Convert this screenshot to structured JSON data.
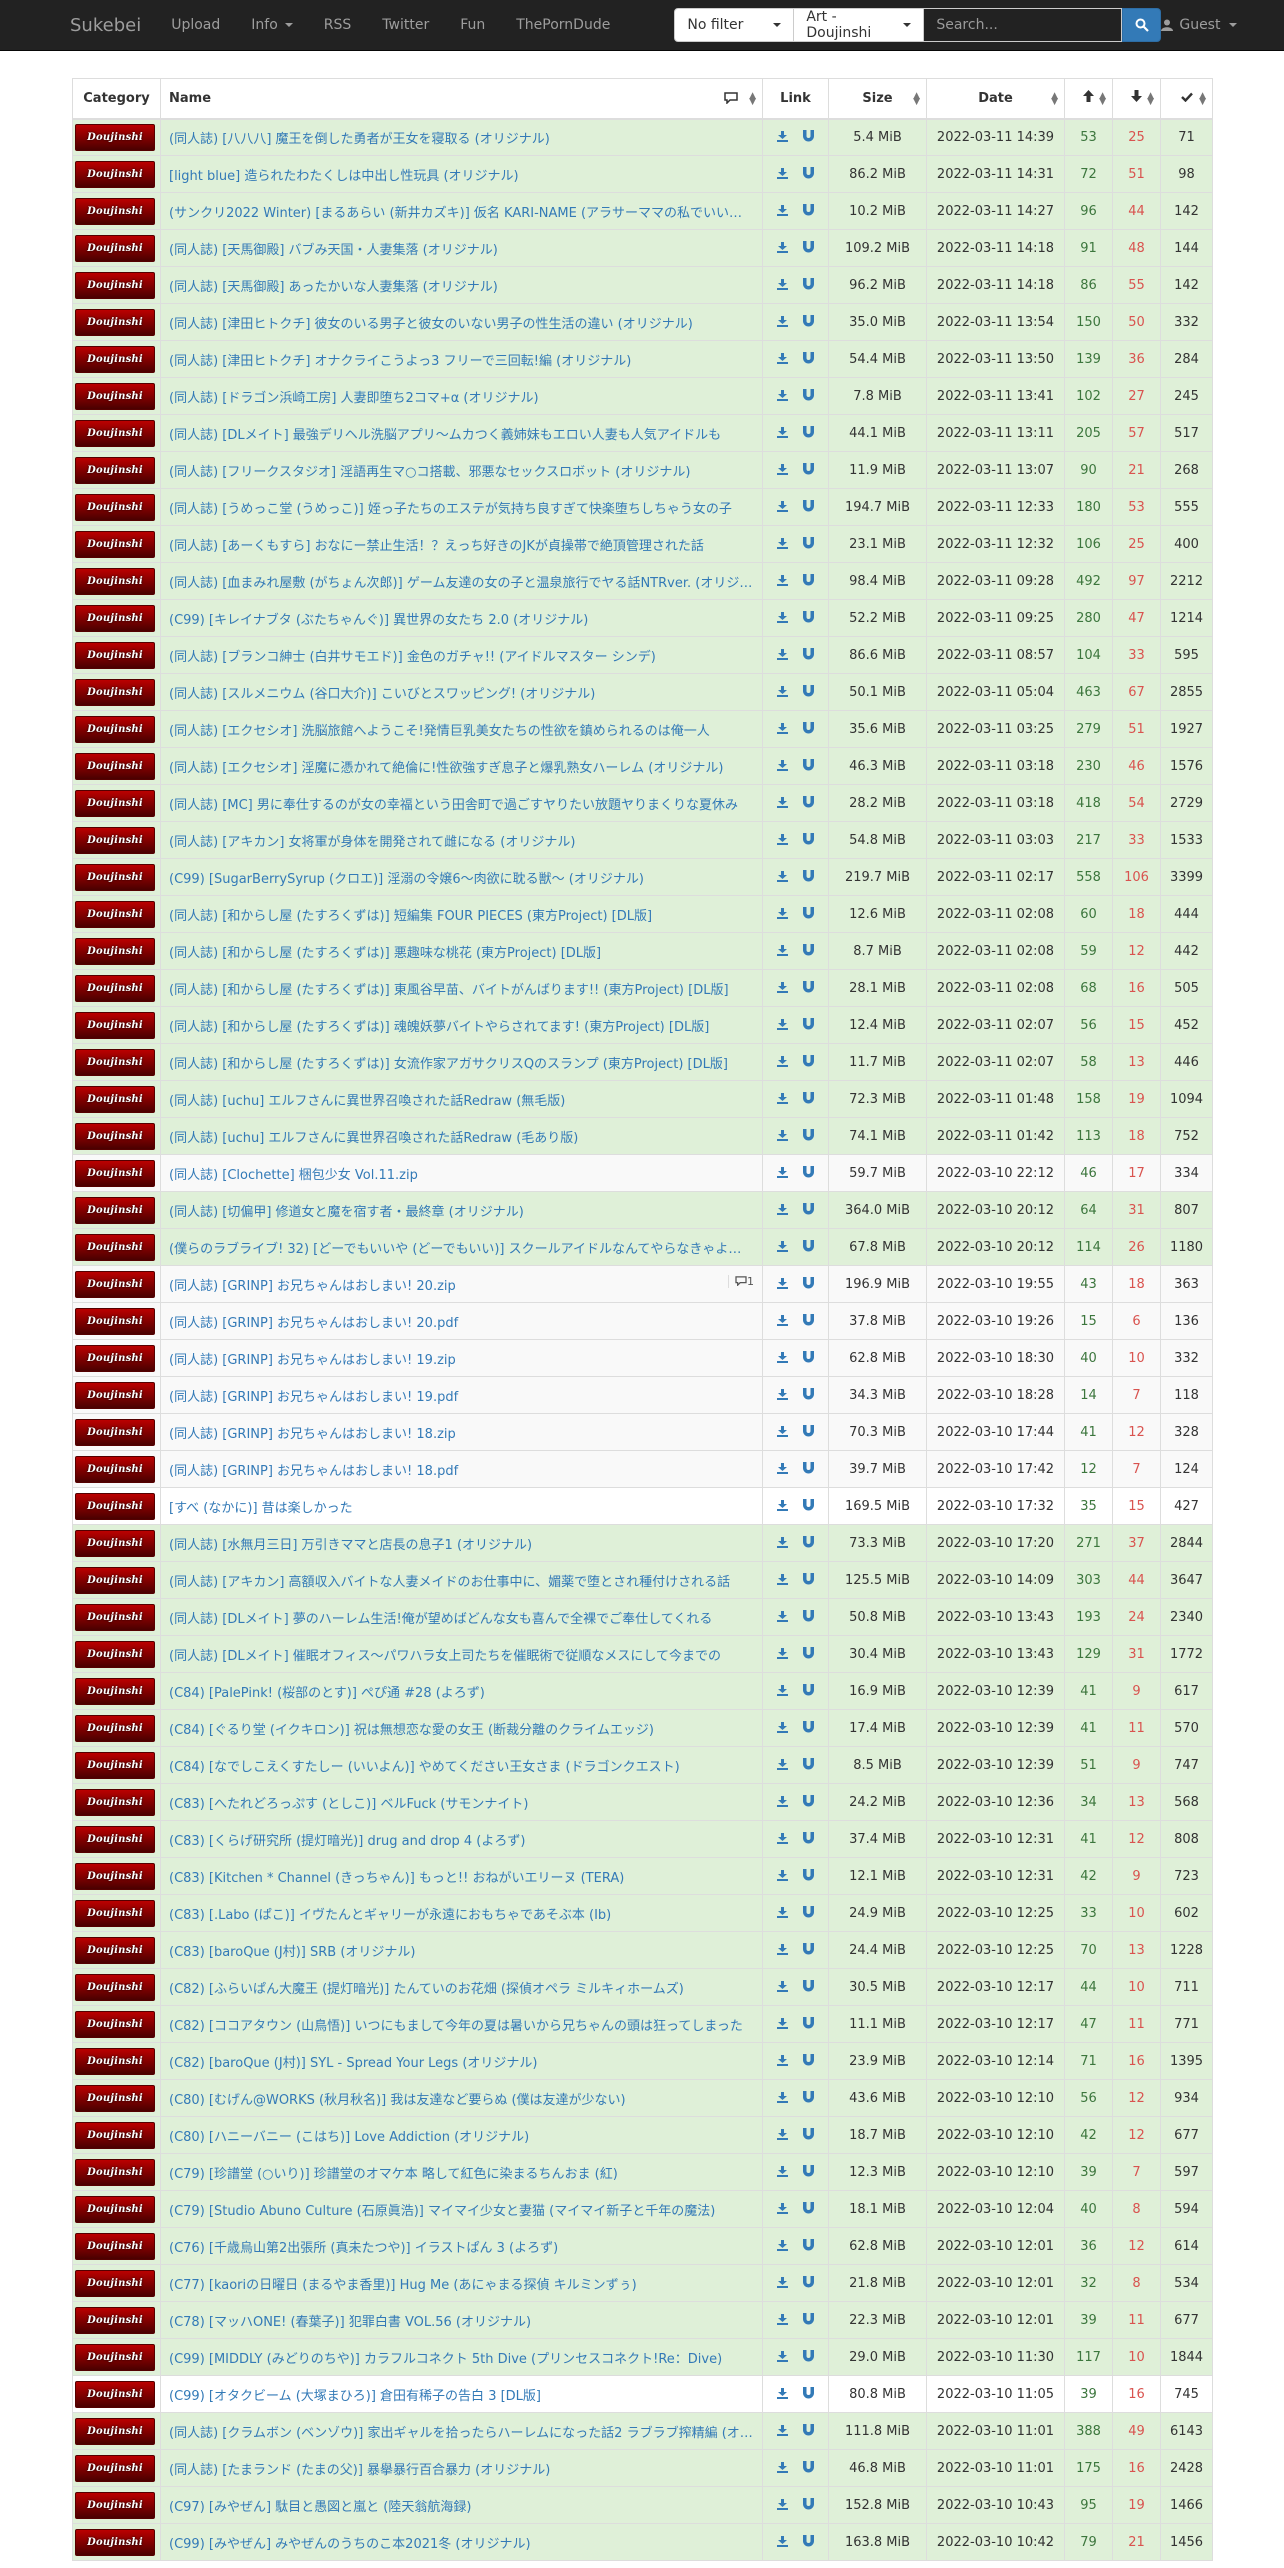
{
  "nav": {
    "brand": "Sukebei",
    "items": [
      {
        "label": "Upload"
      },
      {
        "label": "Info"
      },
      {
        "label": "RSS"
      },
      {
        "label": "Twitter"
      },
      {
        "label": "Fun"
      },
      {
        "label": "ThePornDude"
      }
    ],
    "filter_value": "No filter",
    "category_value": "Art - Doujinshi",
    "search_placeholder": "Search...",
    "guest_label": "Guest"
  },
  "table": {
    "headers": {
      "category": "Category",
      "name": "Name",
      "link": "Link",
      "size": "Size",
      "date": "Date"
    },
    "category_badge": "Doujinshi",
    "rows": [
      {
        "name": "(同人誌) [八八八] 魔王を倒した勇者が王女を寝取る (オリジナル)",
        "size": "5.4 MiB",
        "date": "2022-03-11 14:39",
        "seeders": "53",
        "leechers": "25",
        "completed": "71",
        "status": "success"
      },
      {
        "name": "[light blue] 造られたわたくしは中出し性玩具 (オリジナル)",
        "size": "86.2 MiB",
        "date": "2022-03-11 14:31",
        "seeders": "72",
        "leechers": "51",
        "completed": "98",
        "status": "success"
      },
      {
        "name": "(サンクリ2022 Winter) [まるあらい (新井カズキ)] 仮名 KARI-NAME (アラサーママの私でいいの？",
        "size": "10.2 MiB",
        "date": "2022-03-11 14:27",
        "seeders": "96",
        "leechers": "44",
        "completed": "142",
        "status": "success"
      },
      {
        "name": "(同人誌) [天馬御殿] バブみ天国・人妻集落 (オリジナル)",
        "size": "109.2 MiB",
        "date": "2022-03-11 14:18",
        "seeders": "91",
        "leechers": "48",
        "completed": "144",
        "status": "success"
      },
      {
        "name": "(同人誌) [天馬御殿] あったかいな人妻集落 (オリジナル)",
        "size": "96.2 MiB",
        "date": "2022-03-11 14:18",
        "seeders": "86",
        "leechers": "55",
        "completed": "142",
        "status": "success"
      },
      {
        "name": "(同人誌) [津田ヒトクチ] 彼女のいる男子と彼女のいない男子の性生活の違い (オリジナル)",
        "size": "35.0 MiB",
        "date": "2022-03-11 13:54",
        "seeders": "150",
        "leechers": "50",
        "completed": "332",
        "status": "success"
      },
      {
        "name": "(同人誌) [津田ヒトクチ] オナクライこうよっ3 フリーで三回転!編 (オリジナル)",
        "size": "54.4 MiB",
        "date": "2022-03-11 13:50",
        "seeders": "139",
        "leechers": "36",
        "completed": "284",
        "status": "success"
      },
      {
        "name": "(同人誌) [ドラゴン浜崎工房] 人妻即堕ち2コマ+α (オリジナル)",
        "size": "7.8 MiB",
        "date": "2022-03-11 13:41",
        "seeders": "102",
        "leechers": "27",
        "completed": "245",
        "status": "success"
      },
      {
        "name": "(同人誌) [DLメイト] 最強デリヘル洗脳アプリ～ムカつく義姉妹もエロい人妻も人気アイドルも",
        "size": "44.1 MiB",
        "date": "2022-03-11 13:11",
        "seeders": "205",
        "leechers": "57",
        "completed": "517",
        "status": "success"
      },
      {
        "name": "(同人誌) [フリークスタジオ] 淫語再生マ○コ搭載、邪悪なセックスロボット (オリジナル)",
        "size": "11.9 MiB",
        "date": "2022-03-11 13:07",
        "seeders": "90",
        "leechers": "21",
        "completed": "268",
        "status": "success"
      },
      {
        "name": "(同人誌) [うめっこ堂 (うめっこ)] 姪っ子たちのエステが気持ち良すぎて快楽堕ちしちゃう女の子",
        "size": "194.7 MiB",
        "date": "2022-03-11 12:33",
        "seeders": "180",
        "leechers": "53",
        "completed": "555",
        "status": "success"
      },
      {
        "name": "(同人誌) [あーくもすら] おなにー禁止生活！？えっち好きのJKが貞操帯で絶頂管理された話",
        "size": "23.1 MiB",
        "date": "2022-03-11 12:32",
        "seeders": "106",
        "leechers": "25",
        "completed": "400",
        "status": "success"
      },
      {
        "name": "(同人誌) [血まみれ屋敷 (がちょん次郎)] ゲーム友達の女の子と温泉旅行でヤる話NTRver. (オリジナル)",
        "size": "98.4 MiB",
        "date": "2022-03-11 09:28",
        "seeders": "492",
        "leechers": "97",
        "completed": "2212",
        "status": "success"
      },
      {
        "name": "(C99) [キレイナブタ (ぶたちゃんぐ)] 異世界の女たち 2.0 (オリジナル)",
        "size": "52.2 MiB",
        "date": "2022-03-11 09:25",
        "seeders": "280",
        "leechers": "47",
        "completed": "1214",
        "status": "success"
      },
      {
        "name": "(同人誌) [ブランコ紳士 (白井サモエド)] 金色のガチャ!! (アイドルマスター シンデ)",
        "size": "86.6 MiB",
        "date": "2022-03-11 08:57",
        "seeders": "104",
        "leechers": "33",
        "completed": "595",
        "status": "success"
      },
      {
        "name": "(同人誌) [スルメニウム (谷口大介)] こいびとスワッピング! (オリジナル)",
        "size": "50.1 MiB",
        "date": "2022-03-11 05:04",
        "seeders": "463",
        "leechers": "67",
        "completed": "2855",
        "status": "success"
      },
      {
        "name": "(同人誌) [エクセシオ] 洗脳旅館へようこそ!発情巨乳美女たちの性欲を鎮められるのは俺一人",
        "size": "35.6 MiB",
        "date": "2022-03-11 03:25",
        "seeders": "279",
        "leechers": "51",
        "completed": "1927",
        "status": "success"
      },
      {
        "name": "(同人誌) [エクセシオ] 淫魔に憑かれて絶倫に!性欲強すぎ息子と爆乳熟女ハーレム (オリジナル)",
        "size": "46.3 MiB",
        "date": "2022-03-11 03:18",
        "seeders": "230",
        "leechers": "46",
        "completed": "1576",
        "status": "success"
      },
      {
        "name": "(同人誌) [MC] 男に奉仕するのが女の幸福という田舎町で過ごすヤりたい放題ヤりまくりな夏休み",
        "size": "28.2 MiB",
        "date": "2022-03-11 03:18",
        "seeders": "418",
        "leechers": "54",
        "completed": "2729",
        "status": "success"
      },
      {
        "name": "(同人誌) [アキカン] 女将軍が身体を開発されて雌になる (オリジナル)",
        "size": "54.8 MiB",
        "date": "2022-03-11 03:03",
        "seeders": "217",
        "leechers": "33",
        "completed": "1533",
        "status": "success"
      },
      {
        "name": "(C99) [SugarBerrySyrup (クロエ)] 淫溺の令嬢6～肉欲に耽る獣～ (オリジナル)",
        "size": "219.7 MiB",
        "date": "2022-03-11 02:17",
        "seeders": "558",
        "leechers": "106",
        "completed": "3399",
        "status": "success"
      },
      {
        "name": "(同人誌) [和からし屋 (たすろくずは)] 短編集 FOUR PIECES (東方Project) [DL版]",
        "size": "12.6 MiB",
        "date": "2022-03-11 02:08",
        "seeders": "60",
        "leechers": "18",
        "completed": "444",
        "status": "success"
      },
      {
        "name": "(同人誌) [和からし屋 (たすろくずは)] 悪趣味な桃花 (東方Project) [DL版]",
        "size": "8.7 MiB",
        "date": "2022-03-11 02:08",
        "seeders": "59",
        "leechers": "12",
        "completed": "442",
        "status": "success"
      },
      {
        "name": "(同人誌) [和からし屋 (たすろくずは)] 東風谷早苗、バイトがんばります!! (東方Project) [DL版]",
        "size": "28.1 MiB",
        "date": "2022-03-11 02:08",
        "seeders": "68",
        "leechers": "16",
        "completed": "505",
        "status": "success"
      },
      {
        "name": "(同人誌) [和からし屋 (たすろくずは)] 魂魄妖夢バイトやらされてます! (東方Project) [DL版]",
        "size": "12.4 MiB",
        "date": "2022-03-11 02:07",
        "seeders": "56",
        "leechers": "15",
        "completed": "452",
        "status": "success"
      },
      {
        "name": "(同人誌) [和からし屋 (たすろくずは)] 女流作家アガサクリスQのスランプ (東方Project) [DL版]",
        "size": "11.7 MiB",
        "date": "2022-03-11 02:07",
        "seeders": "58",
        "leechers": "13",
        "completed": "446",
        "status": "success"
      },
      {
        "name": "(同人誌) [uchu] エルフさんに異世界召喚された話Redraw (無毛版)",
        "size": "72.3 MiB",
        "date": "2022-03-11 01:48",
        "seeders": "158",
        "leechers": "19",
        "completed": "1094",
        "status": "success"
      },
      {
        "name": "(同人誌) [uchu] エルフさんに異世界召喚された話Redraw (毛あり版)",
        "size": "74.1 MiB",
        "date": "2022-03-11 01:42",
        "seeders": "113",
        "leechers": "18",
        "completed": "752",
        "status": "success"
      },
      {
        "name": "(同人誌) [Clochette] 梱包少女 Vol.11.zip",
        "size": "59.7 MiB",
        "date": "2022-03-10 22:12",
        "seeders": "46",
        "leechers": "17",
        "completed": "334",
        "status": "default"
      },
      {
        "name": "(同人誌) [切偏甲] 修道女と魔を宿す者・最終章 (オリジナル)",
        "size": "364.0 MiB",
        "date": "2022-03-10 20:12",
        "seeders": "64",
        "leechers": "31",
        "completed": "807",
        "status": "success"
      },
      {
        "name": "(僕らのラブライブ! 32) [どーでもいいや (どーでもいい)] スクールアイドルなんてやらなきゃよかった",
        "size": "67.8 MiB",
        "date": "2022-03-10 20:12",
        "seeders": "114",
        "leechers": "26",
        "completed": "1180",
        "status": "success"
      },
      {
        "name": "(同人誌) [GRINP] お兄ちゃんはおしまい! 20.zip",
        "size": "196.9 MiB",
        "date": "2022-03-10 19:55",
        "seeders": "43",
        "leechers": "18",
        "completed": "363",
        "status": "default",
        "comments": "1"
      },
      {
        "name": "(同人誌) [GRINP] お兄ちゃんはおしまい! 20.pdf",
        "size": "37.8 MiB",
        "date": "2022-03-10 19:26",
        "seeders": "15",
        "leechers": "6",
        "completed": "136",
        "status": "default"
      },
      {
        "name": "(同人誌) [GRINP] お兄ちゃんはおしまい! 19.zip",
        "size": "62.8 MiB",
        "date": "2022-03-10 18:30",
        "seeders": "40",
        "leechers": "10",
        "completed": "332",
        "status": "default"
      },
      {
        "name": "(同人誌) [GRINP] お兄ちゃんはおしまい! 19.pdf",
        "size": "34.3 MiB",
        "date": "2022-03-10 18:28",
        "seeders": "14",
        "leechers": "7",
        "completed": "118",
        "status": "default"
      },
      {
        "name": "(同人誌) [GRINP] お兄ちゃんはおしまい! 18.zip",
        "size": "70.3 MiB",
        "date": "2022-03-10 17:44",
        "seeders": "41",
        "leechers": "12",
        "completed": "328",
        "status": "default"
      },
      {
        "name": "(同人誌) [GRINP] お兄ちゃんはおしまい! 18.pdf",
        "size": "39.7 MiB",
        "date": "2022-03-10 17:42",
        "seeders": "12",
        "leechers": "7",
        "completed": "124",
        "status": "default"
      },
      {
        "name": "[すべ (なかに)] 昔は楽しかった",
        "size": "169.5 MiB",
        "date": "2022-03-10 17:32",
        "seeders": "35",
        "leechers": "15",
        "completed": "427",
        "status": "plain"
      },
      {
        "name": "(同人誌) [水無月三日] 万引きママと店長の息子1 (オリジナル)",
        "size": "73.3 MiB",
        "date": "2022-03-10 17:20",
        "seeders": "271",
        "leechers": "37",
        "completed": "2844",
        "status": "success"
      },
      {
        "name": "(同人誌) [アキカン] 高額収入バイトな人妻メイドのお仕事中に、媚薬で堕とされ種付けされる話",
        "size": "125.5 MiB",
        "date": "2022-03-10 14:09",
        "seeders": "303",
        "leechers": "44",
        "completed": "3647",
        "status": "success"
      },
      {
        "name": "(同人誌) [DLメイト] 夢のハーレム生活!俺が望めばどんな女も喜んで全裸でご奉仕してくれる",
        "size": "50.8 MiB",
        "date": "2022-03-10 13:43",
        "seeders": "193",
        "leechers": "24",
        "completed": "2340",
        "status": "success"
      },
      {
        "name": "(同人誌) [DLメイト] 催眠オフィス～パワハラ女上司たちを催眠術で従順なメスにして今までの",
        "size": "30.4 MiB",
        "date": "2022-03-10 13:43",
        "seeders": "129",
        "leechers": "31",
        "completed": "1772",
        "status": "success"
      },
      {
        "name": "(C84) [PalePink! (桜部のとす)] ぺぴ通 #28 (よろず)",
        "size": "16.9 MiB",
        "date": "2022-03-10 12:39",
        "seeders": "41",
        "leechers": "9",
        "completed": "617",
        "status": "success"
      },
      {
        "name": "(C84) [ぐるり堂 (イクキロン)] 祝は無想恋な愛の女王 (断裁分離のクライムエッジ)",
        "size": "17.4 MiB",
        "date": "2022-03-10 12:39",
        "seeders": "41",
        "leechers": "11",
        "completed": "570",
        "status": "success"
      },
      {
        "name": "(C84) [なでしこえくすたしー (いいよん)] やめてください王女さま (ドラゴンクエスト)",
        "size": "8.5 MiB",
        "date": "2022-03-10 12:39",
        "seeders": "51",
        "leechers": "9",
        "completed": "747",
        "status": "success"
      },
      {
        "name": "(C83) [へたれどろっぷす (としこ)] ベルFuck (サモンナイト)",
        "size": "24.2 MiB",
        "date": "2022-03-10 12:36",
        "seeders": "34",
        "leechers": "13",
        "completed": "568",
        "status": "success"
      },
      {
        "name": "(C83) [くらげ研究所 (提灯暗光)] drug and drop 4 (よろず)",
        "size": "37.4 MiB",
        "date": "2022-03-10 12:31",
        "seeders": "41",
        "leechers": "12",
        "completed": "808",
        "status": "success"
      },
      {
        "name": "(C83) [Kitchen * Channel (きっちゃん)] もっと!! おねがいエリーヌ (TERA)",
        "size": "12.1 MiB",
        "date": "2022-03-10 12:31",
        "seeders": "42",
        "leechers": "9",
        "completed": "723",
        "status": "success"
      },
      {
        "name": "(C83) [.Labo (ぱこ)] イヴたんとギャリーが永遠におもちゃであそぶ本 (Ib)",
        "size": "24.9 MiB",
        "date": "2022-03-10 12:25",
        "seeders": "33",
        "leechers": "10",
        "completed": "602",
        "status": "success"
      },
      {
        "name": "(C83) [baroQue (J村)] SRB (オリジナル)",
        "size": "24.4 MiB",
        "date": "2022-03-10 12:25",
        "seeders": "70",
        "leechers": "13",
        "completed": "1228",
        "status": "success"
      },
      {
        "name": "(C82) [ふらいぱん大魔王 (提灯暗光)] たんていのお花畑 (探偵オペラ ミルキィホームズ)",
        "size": "30.5 MiB",
        "date": "2022-03-10 12:17",
        "seeders": "44",
        "leechers": "10",
        "completed": "711",
        "status": "success"
      },
      {
        "name": "(C82) [ココアタウン (山鳥悟)] いつにもまして今年の夏は暑いから兄ちゃんの頭は狂ってしまった",
        "size": "11.1 MiB",
        "date": "2022-03-10 12:17",
        "seeders": "47",
        "leechers": "11",
        "completed": "771",
        "status": "success"
      },
      {
        "name": "(C82) [baroQue (J村)] SYL - Spread Your Legs (オリジナル)",
        "size": "23.9 MiB",
        "date": "2022-03-10 12:14",
        "seeders": "71",
        "leechers": "16",
        "completed": "1395",
        "status": "success"
      },
      {
        "name": "(C80) [むげん@WORKS (秋月秋名)] 我は友達など要らぬ (僕は友達が少ない)",
        "size": "43.6 MiB",
        "date": "2022-03-10 12:10",
        "seeders": "56",
        "leechers": "12",
        "completed": "934",
        "status": "success"
      },
      {
        "name": "(C80) [ハニーバニー (こはち)] Love Addiction (オリジナル)",
        "size": "18.7 MiB",
        "date": "2022-03-10 12:10",
        "seeders": "42",
        "leechers": "12",
        "completed": "677",
        "status": "success"
      },
      {
        "name": "(C79) [珍譜堂 (○いり)] 珍譜堂のオマケ本 略して紅色に染まるちんおま (紅)",
        "size": "12.3 MiB",
        "date": "2022-03-10 12:10",
        "seeders": "39",
        "leechers": "7",
        "completed": "597",
        "status": "success"
      },
      {
        "name": "(C79) [Studio Abuno Culture (石原眞浩)] マイマイ少女と妻猫 (マイマイ新子と千年の魔法)",
        "size": "18.1 MiB",
        "date": "2022-03-10 12:04",
        "seeders": "40",
        "leechers": "8",
        "completed": "594",
        "status": "success"
      },
      {
        "name": "(C76) [千歳烏山第2出張所 (真未たつや)] イラストぱん 3 (よろず)",
        "size": "62.8 MiB",
        "date": "2022-03-10 12:01",
        "seeders": "36",
        "leechers": "12",
        "completed": "614",
        "status": "success"
      },
      {
        "name": "(C77) [kaoriの日曜日 (まるやま香里)] Hug Me (あにゃまる探偵 キルミンずぅ)",
        "size": "21.8 MiB",
        "date": "2022-03-10 12:01",
        "seeders": "32",
        "leechers": "8",
        "completed": "534",
        "status": "success"
      },
      {
        "name": "(C78) [マッハONE! (春葉子)] 犯罪白書 VOL.56 (オリジナル)",
        "size": "22.3 MiB",
        "date": "2022-03-10 12:01",
        "seeders": "39",
        "leechers": "11",
        "completed": "677",
        "status": "success"
      },
      {
        "name": "(C99) [MIDDLY (みどりのちや)] カラフルコネクト 5th Dive (プリンセスコネクト!Re：Dive)",
        "size": "29.0 MiB",
        "date": "2022-03-10 11:30",
        "seeders": "117",
        "leechers": "10",
        "completed": "1844",
        "status": "success"
      },
      {
        "name": "(C99) [オタクビーム (大塚まひろ)] 倉田有稀子の告白 3 [DL版]",
        "size": "80.8 MiB",
        "date": "2022-03-10 11:05",
        "seeders": "39",
        "leechers": "16",
        "completed": "745",
        "status": "plain"
      },
      {
        "name": "(同人誌) [クラムボン (ベンゾウ)] 家出ギャルを拾ったらハーレムになった話2 ラブラブ搾精編 (オリジナル)",
        "size": "111.8 MiB",
        "date": "2022-03-10 11:01",
        "seeders": "388",
        "leechers": "49",
        "completed": "6143",
        "status": "success"
      },
      {
        "name": "(同人誌) [たまランド (たまの父)] 暴擧暴行百合暴力 (オリジナル)",
        "size": "46.8 MiB",
        "date": "2022-03-10 11:01",
        "seeders": "175",
        "leechers": "16",
        "completed": "2428",
        "status": "success"
      },
      {
        "name": "(C97) [みやぜん] 駄目と愚図と嵐と (陸天翁航海録)",
        "size": "152.8 MiB",
        "date": "2022-03-10 10:43",
        "seeders": "95",
        "leechers": "19",
        "completed": "1466",
        "status": "success"
      },
      {
        "name": "(C99) [みやぜん] みやぜんのうちのこ本2021冬 (オリジナル)",
        "size": "163.8 MiB",
        "date": "2022-03-10 10:42",
        "seeders": "79",
        "leechers": "21",
        "completed": "1456",
        "status": "success"
      }
    ]
  }
}
